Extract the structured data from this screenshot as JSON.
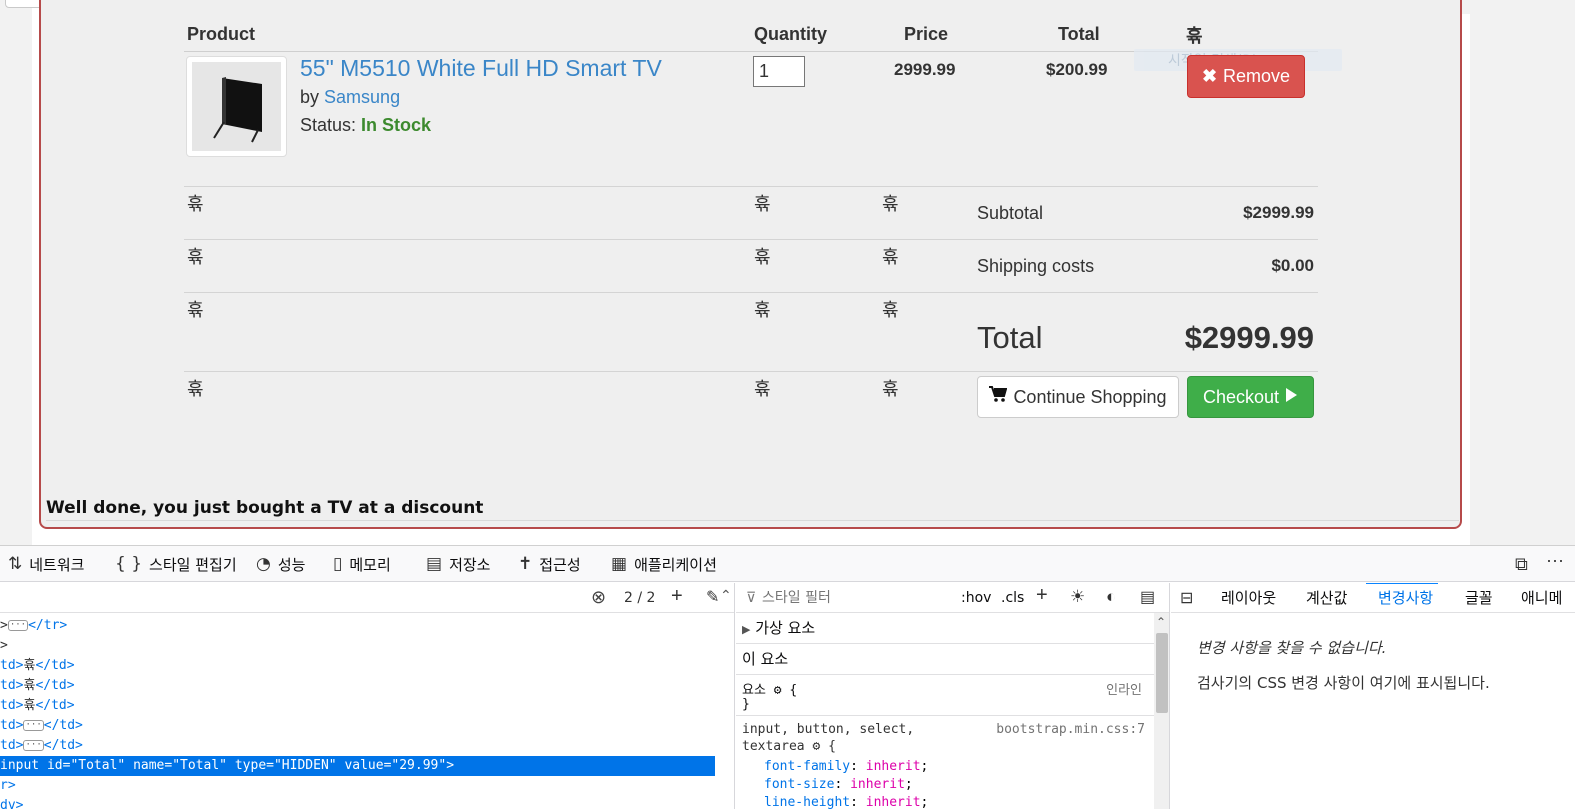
{
  "cart": {
    "headers": {
      "product": "Product",
      "quantity": "Quantity",
      "price": "Price",
      "total": "Total",
      "extra": "휶"
    },
    "item": {
      "name": "55\" M5510 White Full HD Smart TV",
      "by_label": "by",
      "brand": "Samsung",
      "status_label": "Status:",
      "status": "In Stock",
      "quantity": "1",
      "price": "2999.99",
      "total": "$200.99",
      "remove_label": "Remove"
    },
    "placeholder_char": "휶",
    "ghost_text": "시작일 검색(R)",
    "summary": {
      "subtotal_label": "Subtotal",
      "subtotal_value": "$2999.99",
      "shipping_label": "Shipping costs",
      "shipping_value": "$0.00",
      "total_label": "Total",
      "total_value": "$2999.99"
    },
    "continue_label": "Continue Shopping",
    "checkout_label": "Checkout",
    "message": "Well done, you just bought a TV at a discount"
  },
  "devtools": {
    "tabs": [
      "네트워크",
      "스타일 편집기",
      "성능",
      "메모리",
      "저장소",
      "접근성",
      "애플리케이션"
    ],
    "search_count": "2 / 2",
    "html_lines": {
      "l1_end": "</tr>",
      "l2": ">",
      "td_open": "td>",
      "td_close": "</td>",
      "glyph": "휶",
      "sel_tag": "input",
      "sel_id_n": "id",
      "sel_id_v": "\"Total\"",
      "sel_name_n": "name",
      "sel_name_v": "\"Total\"",
      "sel_type_n": "type",
      "sel_type_v": "\"HIDDEN\"",
      "sel_value_n": "value",
      "sel_value_v": "\"29.99\"",
      "after1": "r>",
      "after2": "dv>"
    },
    "css": {
      "filter_placeholder": "스타일 필터",
      "hov": ":hov",
      "cls": ".cls",
      "pseudo": "가상 요소",
      "this_element": "이 요소",
      "element_rule": "요소",
      "inline": "인라인",
      "selector": "input, button, select,",
      "selector2": "textarea",
      "source": "bootstrap.min.css:7",
      "decls": [
        {
          "prop": "font-family",
          "val": "inherit"
        },
        {
          "prop": "font-size",
          "val": "inherit"
        },
        {
          "prop": "line-height",
          "val": "inherit"
        }
      ]
    },
    "changes": {
      "tabs": [
        "레이아웃",
        "계산값",
        "변경사항",
        "글꼴",
        "애니메"
      ],
      "empty_title": "변경 사항을 찾을 수 없습니다.",
      "empty_desc": "검사기의 CSS 변경 사항이 여기에 표시됩니다."
    }
  }
}
